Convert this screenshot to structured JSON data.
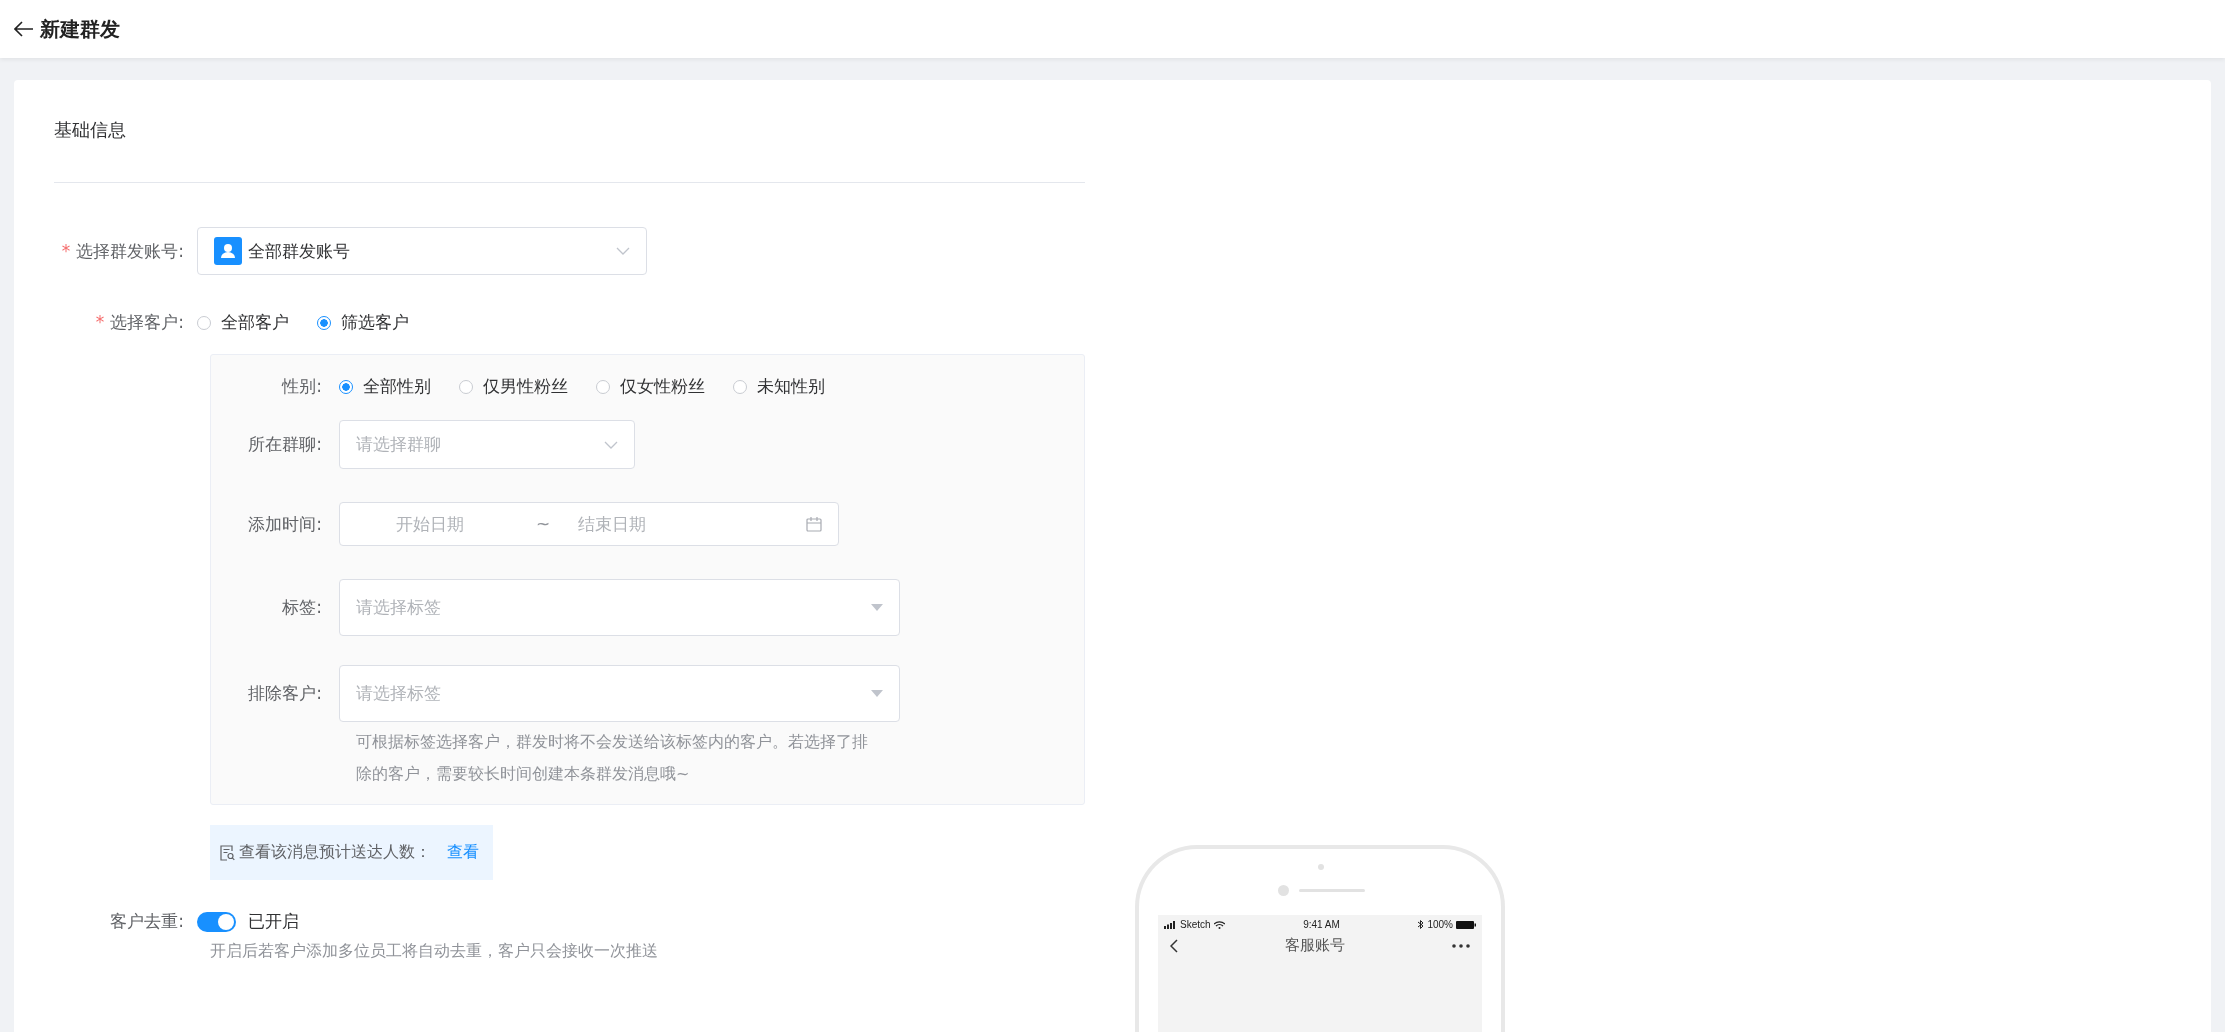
{
  "header": {
    "title": "新建群发"
  },
  "section": {
    "title": "基础信息"
  },
  "account": {
    "required_mark": "*",
    "label": "选择群发账号:",
    "value": "全部群发账号"
  },
  "customers": {
    "required_mark": "*",
    "label": "选择客户:",
    "options": [
      {
        "label": "全部客户",
        "selected": false
      },
      {
        "label": "筛选客户",
        "selected": true
      }
    ]
  },
  "filter": {
    "gender": {
      "label": "性别:",
      "options": [
        {
          "label": "全部性别",
          "selected": true
        },
        {
          "label": "仅男性粉丝",
          "selected": false
        },
        {
          "label": "仅女性粉丝",
          "selected": false
        },
        {
          "label": "未知性别",
          "selected": false
        }
      ]
    },
    "group_chat": {
      "label": "所在群聊:",
      "placeholder": "请选择群聊"
    },
    "add_time": {
      "label": "添加时间:",
      "start_placeholder": "开始日期",
      "separator": "~",
      "end_placeholder": "结束日期"
    },
    "tags": {
      "label": "标签:",
      "placeholder": "请选择标签"
    },
    "exclude": {
      "label": "排除客户:",
      "placeholder": "请选择标签",
      "hint": "可根据标签选择客户，群发时将不会发送给该标签内的客户。若选择了排除的客户，需要较长时间创建本条群发消息哦~"
    }
  },
  "reach": {
    "text": "查看该消息预计送达人数：",
    "link": "查看"
  },
  "dedupe": {
    "label": "客户去重:",
    "on": true,
    "status": "已开启",
    "hint": "开启后若客户添加多位员工将自动去重，客户只会接收一次推送"
  },
  "phone": {
    "carrier": "Sketch",
    "time": "9:41 AM",
    "battery": "100%",
    "title": "客服账号"
  }
}
